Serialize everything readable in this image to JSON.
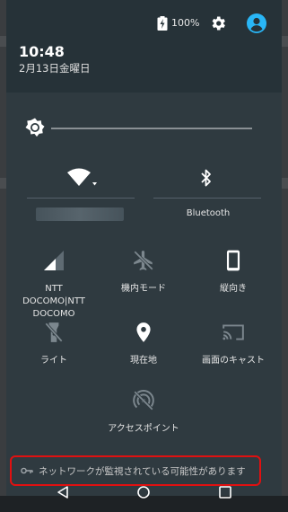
{
  "status_bar": {
    "battery_percent": "100%"
  },
  "header": {
    "time": "10:48",
    "date": "2月13日金曜日"
  },
  "brightness": {
    "level": 0.0
  },
  "large_tiles": [
    {
      "id": "wifi",
      "label": ""
    },
    {
      "id": "bluetooth",
      "label": "Bluetooth"
    }
  ],
  "tiles": [
    {
      "id": "mobile-data",
      "label": "NTT DOCOMO|NTT DOCOMO",
      "icon": "signal-icon"
    },
    {
      "id": "airplane",
      "label": "機内モード",
      "icon": "airplane-icon"
    },
    {
      "id": "rotation",
      "label": "縦向き",
      "icon": "phone-portrait-icon"
    },
    {
      "id": "flashlight",
      "label": "ライト",
      "icon": "flashlight-icon"
    },
    {
      "id": "location",
      "label": "現在地",
      "icon": "location-pin-icon"
    },
    {
      "id": "cast",
      "label": "画面のキャスト",
      "icon": "cast-icon"
    },
    {
      "id": "hotspot",
      "label": "アクセスポイント",
      "icon": "hotspot-icon"
    }
  ],
  "warning": {
    "text": "ネットワークが監視されている可能性があります",
    "icon": "key-icon",
    "highlight_color": "#e01010"
  },
  "colors": {
    "shade": "#263238",
    "panel": "#2f3a40",
    "avatar": "#29b6f6"
  }
}
